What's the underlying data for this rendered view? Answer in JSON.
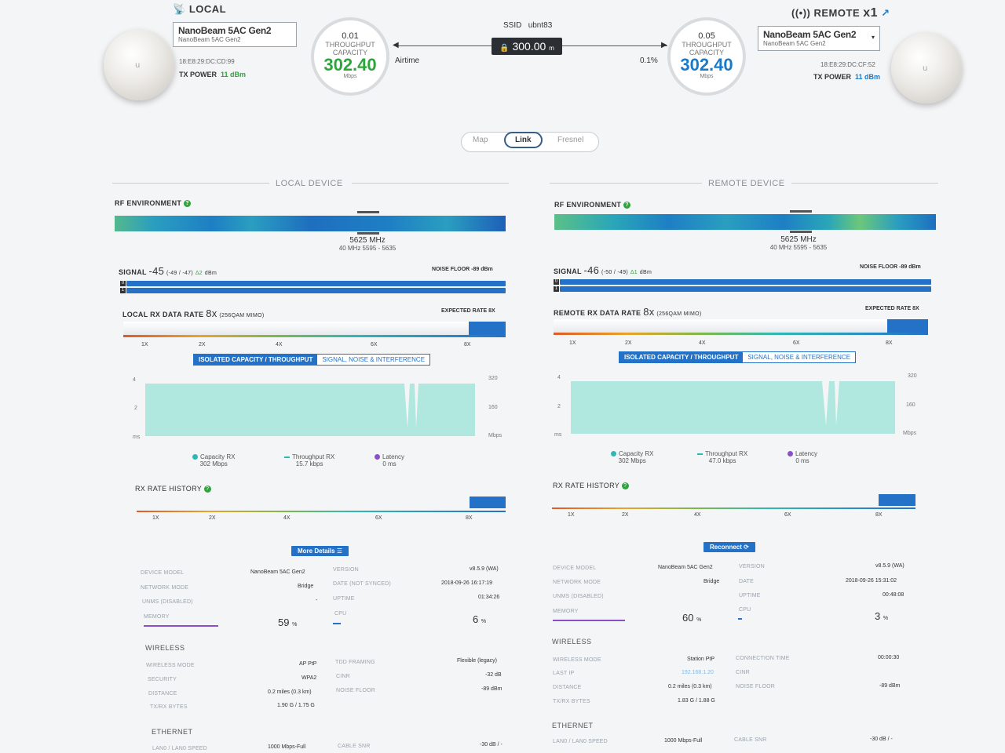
{
  "colors": {
    "accent": "#2471c8",
    "good": "#2da53a",
    "capacity": "#a8e6dc",
    "warn_text": "#888"
  },
  "local": {
    "title": "LOCAL",
    "device_name": "NanoBeam 5AC Gen2",
    "device_sub": "NanoBeam 5AC Gen2",
    "mac": "18:E8:29:DC:CD:99",
    "tx_power_label": "TX POWER",
    "tx_power_value": "11 dBm",
    "capacity_top": "0.01",
    "capacity_label1": "THROUGHPUT",
    "capacity_label2": "CAPACITY",
    "capacity_value": "302.40",
    "capacity_unit": "Mbps"
  },
  "remote": {
    "title": "REMOTE",
    "count": "x1",
    "device_name": "NanoBeam 5AC Gen2",
    "device_sub": "NanoBeam 5AC Gen2",
    "mac": "18:E8:29:DC:CF:52",
    "tx_power_label": "TX POWER",
    "tx_power_value": "11 dBm",
    "capacity_top": "0.05",
    "capacity_label1": "THROUGHPUT",
    "capacity_label2": "CAPACITY",
    "capacity_value": "302.40",
    "capacity_unit": "Mbps"
  },
  "link": {
    "ssid_label": "SSID",
    "ssid": "ubnt83",
    "distance": "300.00",
    "distance_unit": "m",
    "airtime_label": "Airtime",
    "airtime_value": "0.1",
    "airtime_unit": "%"
  },
  "tabs": [
    "Map",
    "Link",
    "Fresnel"
  ],
  "active_tab": "Link",
  "panels": {
    "local": {
      "section_title": "LOCAL DEVICE",
      "rf_label": "RF ENVIRONMENT",
      "freq": "5625 MHz",
      "freq_sub": "40 MHz 5595 - 5635",
      "signal_label": "SIGNAL",
      "signal_value": "-45",
      "signal_detail": "(-49 / -47)",
      "signal_delta": "Δ2",
      "signal_unit": "dBm",
      "noise_floor": "NOISE FLOOR -89 dBm",
      "rate_label": "LOCAL RX DATA RATE",
      "rate_value": "8x",
      "rate_detail": "(256QAM MIMO)",
      "expected_rate": "EXPECTED RATE 8X",
      "rate_ticks": [
        "1X",
        "2X",
        "4X",
        "6X",
        "8X"
      ],
      "toggle_on": "ISOLATED CAPACITY / THROUGHPUT",
      "toggle_off": "SIGNAL, NOISE & INTERFERENCE",
      "axis_left": [
        "4",
        "2",
        "ms"
      ],
      "axis_right": [
        "320",
        "160",
        "Mbps"
      ],
      "legend": [
        {
          "name": "Capacity RX",
          "value": "302 Mbps"
        },
        {
          "name": "Throughput RX",
          "value": "15.7 kbps"
        },
        {
          "name": "Latency",
          "value": "0 ms"
        }
      ],
      "history_label": "RX RATE HISTORY",
      "history_ticks": [
        "1X",
        "2X",
        "4X",
        "6X",
        "8X"
      ],
      "button": "More Details",
      "details": {
        "device_model_label": "DEVICE MODEL",
        "device_model": "NanoBeam 5AC Gen2",
        "network_mode_label": "NETWORK MODE",
        "network_mode": "Bridge",
        "unms_label": "UNMS (DISABLED)",
        "unms_value": "-",
        "memory_label": "MEMORY",
        "memory_value": "59",
        "memory_unit": "%",
        "version_label": "VERSION",
        "version": "v8.5.9 (WA)",
        "date_label": "DATE (NOT SYNCED)",
        "date": "2018-09-26 16:17:19",
        "uptime_label": "UPTIME",
        "uptime": "01:34:26",
        "cpu_label": "CPU",
        "cpu_value": "6",
        "cpu_unit": "%"
      },
      "wireless_title": "WIRELESS",
      "wireless": {
        "mode_label": "WIRELESS MODE",
        "mode": "AP PtP",
        "security_label": "SECURITY",
        "security": "WPA2",
        "distance_label": "DISTANCE",
        "distance": "0.2 miles (0.3 km)",
        "bytes_label": "TX/RX BYTES",
        "bytes": "1.90 G / 1.75 G",
        "tdd_label": "TDD FRAMING",
        "tdd": "Flexible (legacy)",
        "cinr_label": "CINR",
        "cinr": "-32 dB",
        "nf_label": "NOISE FLOOR",
        "nf": "-89 dBm"
      },
      "ethernet_title": "ETHERNET",
      "ethernet": {
        "speed_label": "LAN0 / LAN0 SPEED",
        "speed": "1000 Mbps-Full",
        "cable_label": "CABLE SNR",
        "cable": "-30 dB / -"
      }
    },
    "remote": {
      "section_title": "REMOTE DEVICE",
      "rf_label": "RF ENVIRONMENT",
      "freq": "5625 MHz",
      "freq_sub": "40 MHz 5595 - 5635",
      "signal_label": "SIGNAL",
      "signal_value": "-46",
      "signal_detail": "(-50 / -49)",
      "signal_delta": "Δ1",
      "signal_unit": "dBm",
      "noise_floor": "NOISE FLOOR -89 dBm",
      "rate_label": "REMOTE RX DATA RATE",
      "rate_value": "8x",
      "rate_detail": "(256QAM MIMO)",
      "expected_rate": "EXPECTED RATE 8X",
      "rate_ticks": [
        "1X",
        "2X",
        "4X",
        "6X",
        "8X"
      ],
      "toggle_on": "ISOLATED CAPACITY / THROUGHPUT",
      "toggle_off": "SIGNAL, NOISE & INTERFERENCE",
      "axis_left": [
        "4",
        "2",
        "ms"
      ],
      "axis_right": [
        "320",
        "160",
        "Mbps"
      ],
      "legend": [
        {
          "name": "Capacity RX",
          "value": "302 Mbps"
        },
        {
          "name": "Throughput RX",
          "value": "47.0 kbps"
        },
        {
          "name": "Latency",
          "value": "0 ms"
        }
      ],
      "history_label": "RX RATE HISTORY",
      "history_ticks": [
        "1X",
        "2X",
        "4X",
        "6X",
        "8X"
      ],
      "button": "Reconnect",
      "details": {
        "device_model_label": "DEVICE MODEL",
        "device_model": "NanoBeam 5AC Gen2",
        "network_mode_label": "NETWORK MODE",
        "network_mode": "Bridge",
        "unms_label": "UNMS (DISABLED)",
        "unms_value": "",
        "memory_label": "MEMORY",
        "memory_value": "60",
        "memory_unit": "%",
        "version_label": "VERSION",
        "version": "v8.5.9 (WA)",
        "date_label": "DATE",
        "date": "2018-09-26 15:31:02",
        "uptime_label": "UPTIME",
        "uptime": "00:48:08",
        "cpu_label": "CPU",
        "cpu_value": "3",
        "cpu_unit": "%"
      },
      "wireless_title": "WIRELESS",
      "wireless": {
        "mode_label": "WIRELESS MODE",
        "mode": "Station PtP",
        "lastip_label": "LAST IP",
        "lastip": "192.168.1.20",
        "distance_label": "DISTANCE",
        "distance": "0.2 miles (0.3 km)",
        "bytes_label": "TX/RX BYTES",
        "bytes": "1.83 G / 1.88 G",
        "conn_label": "CONNECTION TIME",
        "conn": "00:00:30",
        "cinr_label": "CINR",
        "cinr": "",
        "nf_label": "NOISE FLOOR",
        "nf": "-89 dBm"
      },
      "ethernet_title": "ETHERNET",
      "ethernet": {
        "speed_label": "LAN0 / LAN0 SPEED",
        "speed": "1000 Mbps-Full",
        "cable_label": "CABLE SNR",
        "cable": "-30 dB / -"
      }
    }
  }
}
